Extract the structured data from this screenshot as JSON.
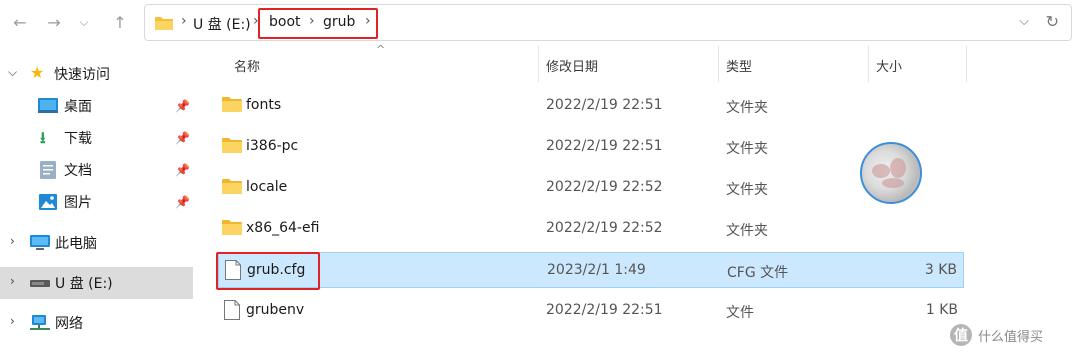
{
  "toolbar": {
    "back_icon": "back-arrow-icon",
    "forward_icon": "forward-arrow-icon",
    "recent_icon": "chevron-down-icon",
    "up_icon": "up-arrow-icon"
  },
  "address": {
    "crumbs": [
      "U 盘 (E:)",
      "boot",
      "grub"
    ],
    "highlight_color": "#e02424"
  },
  "sidebar": {
    "quick_access": "快速访问",
    "items": [
      {
        "label": "桌面",
        "icon": "desktop-icon",
        "pinned": true
      },
      {
        "label": "下载",
        "icon": "download-icon",
        "pinned": true
      },
      {
        "label": "文档",
        "icon": "document-icon",
        "pinned": true
      },
      {
        "label": "图片",
        "icon": "picture-icon",
        "pinned": true
      }
    ],
    "this_pc": "此电脑",
    "usb": "U 盘 (E:)",
    "network": "网络"
  },
  "columns": {
    "name": "名称",
    "date": "修改日期",
    "type": "类型",
    "size": "大小"
  },
  "files": [
    {
      "name": "fonts",
      "date": "2022/2/19 22:51",
      "type": "文件夹",
      "size": "",
      "kind": "folder"
    },
    {
      "name": "i386-pc",
      "date": "2022/2/19 22:51",
      "type": "文件夹",
      "size": "",
      "kind": "folder"
    },
    {
      "name": "locale",
      "date": "2022/2/19 22:52",
      "type": "文件夹",
      "size": "",
      "kind": "folder"
    },
    {
      "name": "x86_64-efi",
      "date": "2022/2/19 22:52",
      "type": "文件夹",
      "size": "",
      "kind": "folder"
    },
    {
      "name": "grub.cfg",
      "date": "2023/2/1 1:49",
      "type": "CFG 文件",
      "size": "3 KB",
      "kind": "file",
      "selected": true
    },
    {
      "name": "grubenv",
      "date": "2022/2/19 22:51",
      "type": "文件",
      "size": "1 KB",
      "kind": "file"
    }
  ],
  "watermark": {
    "badge": "值",
    "text": "什么值得买"
  }
}
